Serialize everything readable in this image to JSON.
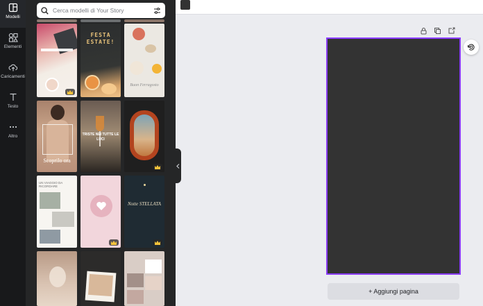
{
  "sidebar": {
    "items": [
      {
        "label": "Modelli",
        "icon": "layout-icon"
      },
      {
        "label": "Elementi",
        "icon": "shapes-icon"
      },
      {
        "label": "Caricamenti",
        "icon": "cloud-upload-icon"
      },
      {
        "label": "Testo",
        "icon": "text-icon"
      },
      {
        "label": "Altro",
        "icon": "more-icon"
      }
    ]
  },
  "search": {
    "placeholder": "Cerca modelli di Your Story"
  },
  "templates": [
    {
      "text": ""
    },
    {
      "text": "FESTA ESTATE!"
    },
    {
      "text": "Buon Ferragosto"
    },
    {
      "text": "Scoprilo ora"
    },
    {
      "text": "TRISTE NEI TUTTE LE LUCI"
    },
    {
      "text": ""
    },
    {
      "text": "UN VIAGGIO DA RICORDARE"
    },
    {
      "text": ""
    },
    {
      "text": "Notte STELLATA"
    },
    {
      "text": ""
    },
    {
      "text": ""
    },
    {
      "text": ""
    }
  ],
  "canvas": {
    "add_page_label": "+ Aggiungi pagina"
  },
  "colors": {
    "accent": "#8b3dff",
    "canvas": "#333333",
    "panel": "#252627",
    "rail": "#18191b"
  }
}
